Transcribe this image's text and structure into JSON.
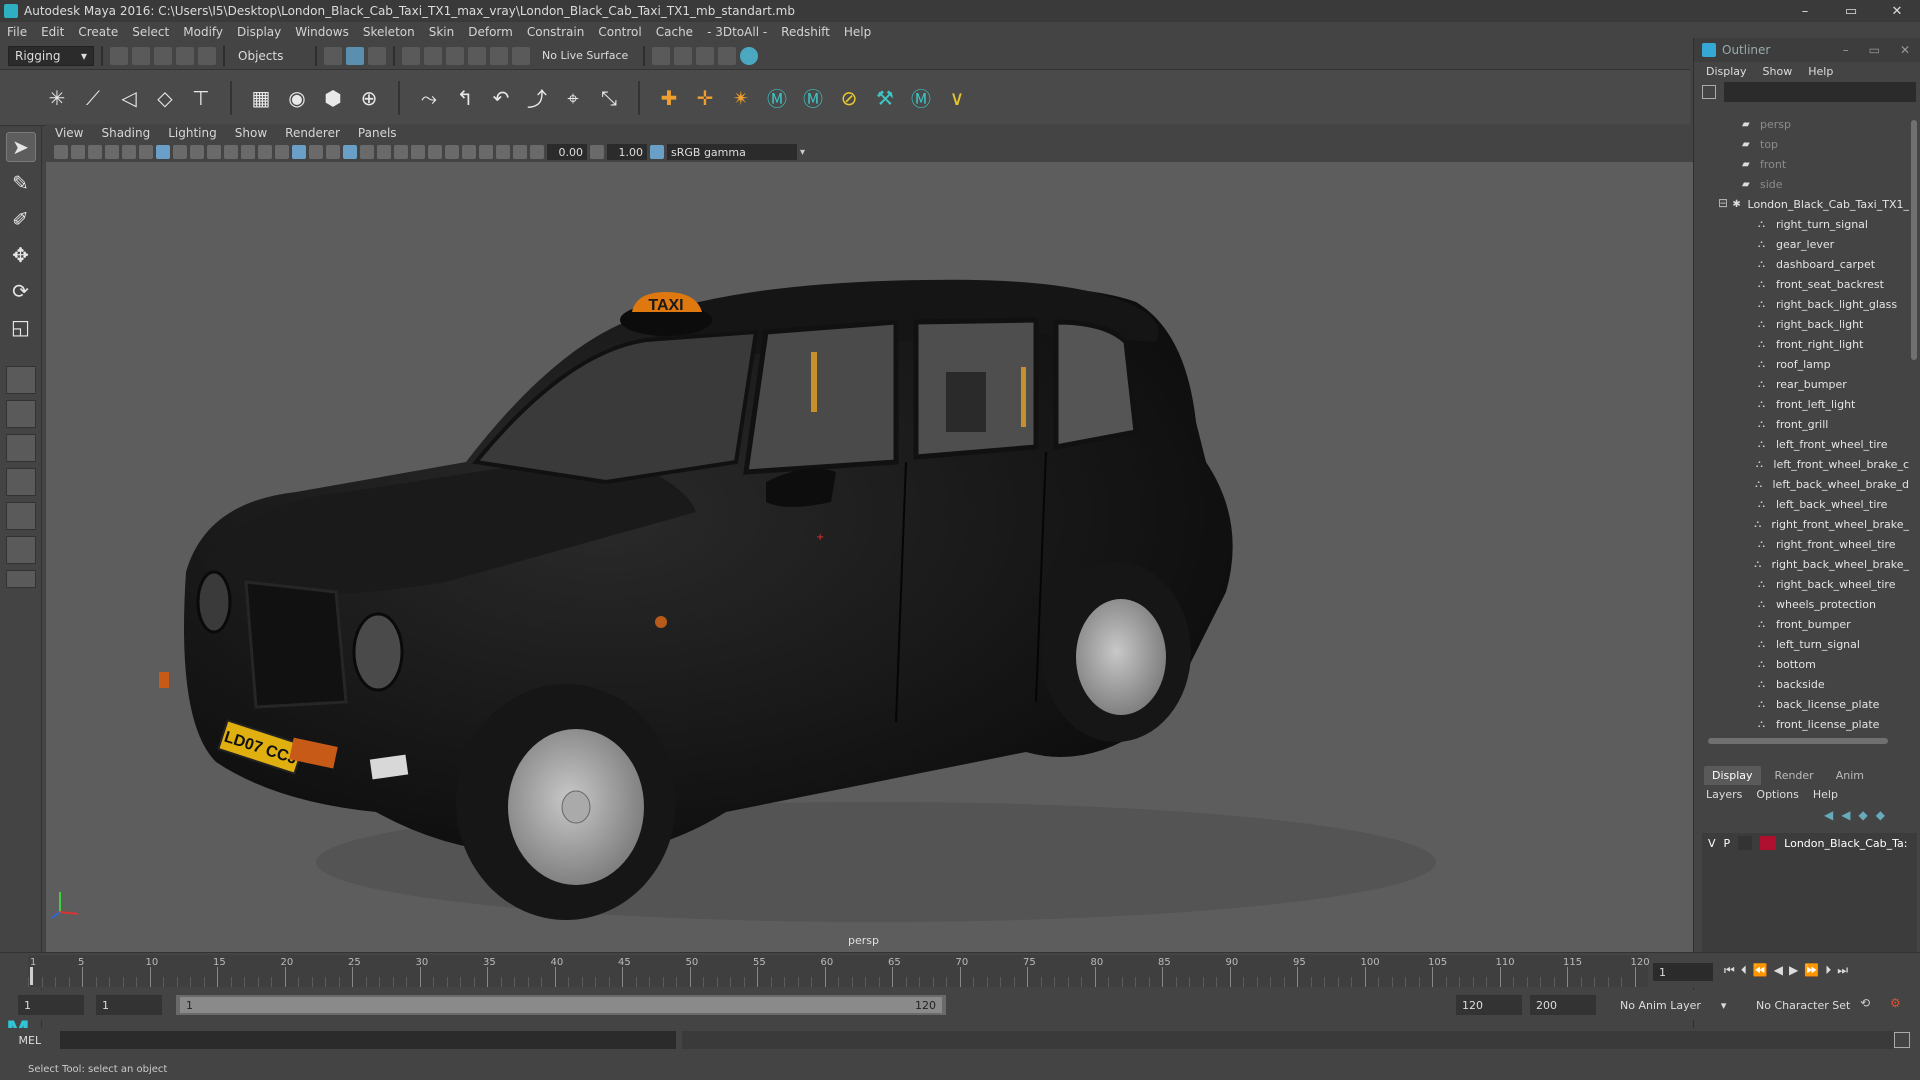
{
  "window": {
    "title": "Autodesk Maya 2016: C:\\Users\\I5\\Desktop\\London_Black_Cab_Taxi_TX1_max_vray\\London_Black_Cab_Taxi_TX1_mb_standart.mb",
    "minimize": "–",
    "restore": "▭",
    "close": "✕"
  },
  "menubar": [
    "File",
    "Edit",
    "Create",
    "Select",
    "Modify",
    "Display",
    "Windows",
    "Skeleton",
    "Skin",
    "Deform",
    "Constrain",
    "Control",
    "Cache",
    "- 3DtoAll -",
    "Redshift",
    "Help"
  ],
  "statusline": {
    "mode": "Rigging",
    "selection_mode": "Objects",
    "live_surface": "No Live Surface"
  },
  "panel": {
    "menus": [
      "View",
      "Shading",
      "Lighting",
      "Show",
      "Renderer",
      "Panels"
    ],
    "exposure": "0.00",
    "gamma_value": "1.00",
    "color_space": "sRGB gamma",
    "camera": "persp"
  },
  "outliner": {
    "title": "Outliner",
    "menus": [
      "Display",
      "Show",
      "Help"
    ],
    "cameras": [
      "persp",
      "top",
      "front",
      "side"
    ],
    "root": "London_Black_Cab_Taxi_TX1_",
    "children": [
      "right_turn_signal",
      "gear_lever",
      "dashboard_carpet",
      "front_seat_backrest",
      "right_back_light_glass",
      "right_back_light",
      "front_right_light",
      "roof_lamp",
      "rear_bumper",
      "front_left_light",
      "front_grill",
      "left_front_wheel_tire",
      "left_front_wheel_brake_c",
      "left_back_wheel_brake_d",
      "left_back_wheel_tire",
      "right_front_wheel_brake_",
      "right_front_wheel_tire",
      "right_back_wheel_brake_",
      "right_back_wheel_tire",
      "wheels_protection",
      "front_bumper",
      "left_turn_signal",
      "bottom",
      "backside",
      "back_license_plate",
      "front_license_plate"
    ]
  },
  "layers": {
    "tabs": [
      "Display",
      "Render",
      "Anim"
    ],
    "active_tab": "Display",
    "menus": [
      "Layers",
      "Options",
      "Help"
    ],
    "row": {
      "v": "V",
      "p": "P",
      "name": "London_Black_Cab_Ta:"
    },
    "swatch_color": "#b01030"
  },
  "timeline": {
    "ticks": [
      "5",
      "10",
      "15",
      "20",
      "25",
      "30",
      "35",
      "40",
      "45",
      "50",
      "55",
      "60",
      "65",
      "70",
      "75",
      "80",
      "85",
      "90",
      "95",
      "100",
      "105",
      "110",
      "115",
      "120"
    ],
    "start_label": "1",
    "current_frame": "1"
  },
  "range": {
    "start": "1",
    "playback_start": "1",
    "inner_start": "1",
    "inner_end": "120",
    "playback_end": "120",
    "end": "200",
    "anim_layer": "No Anim Layer",
    "character_set": "No Character Set"
  },
  "cmdline": {
    "lang": "MEL"
  },
  "helpline": {
    "text": "Select Tool: select an object"
  },
  "car": {
    "plate": "LD07 CCJ",
    "roof_sign": "TAXI"
  }
}
